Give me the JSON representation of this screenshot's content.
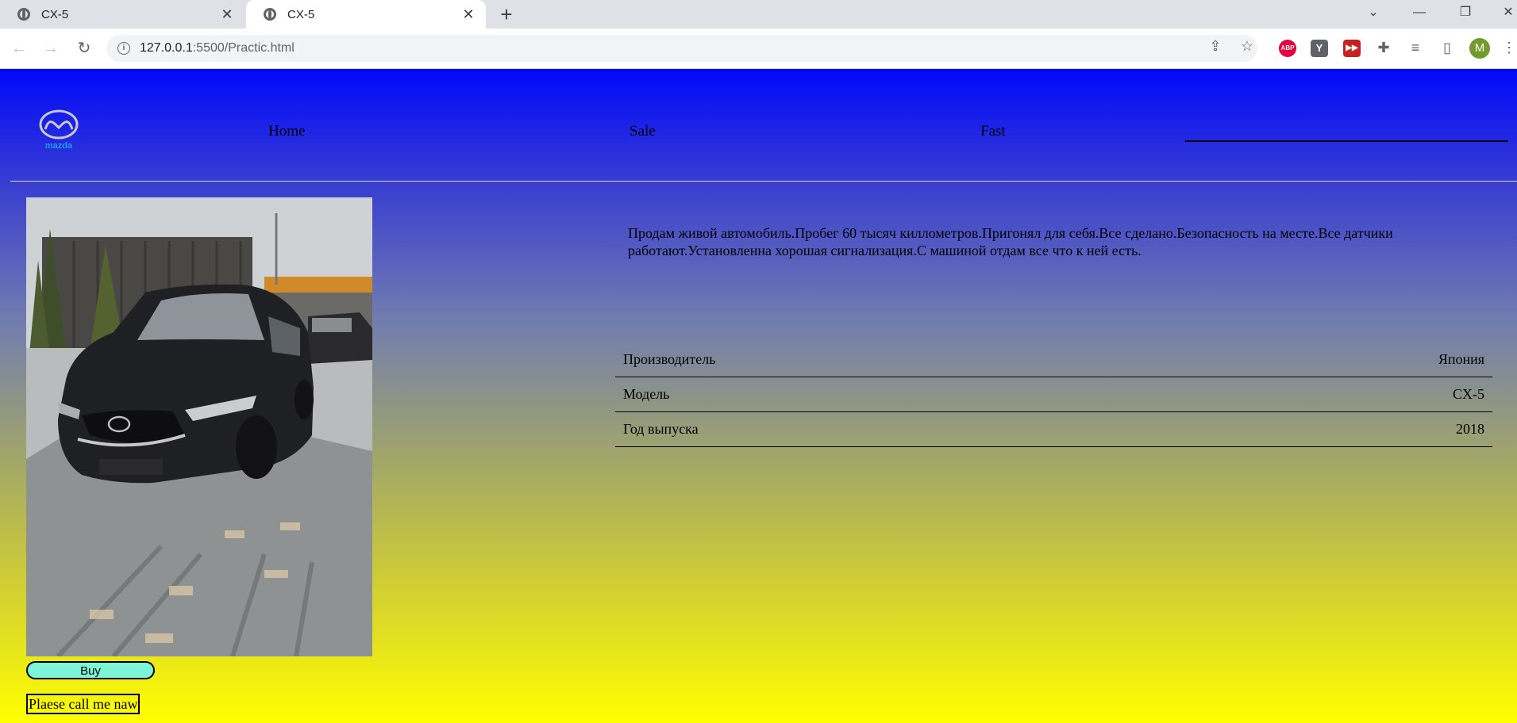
{
  "browser": {
    "tabs": [
      {
        "title": "CX-5",
        "active": false
      },
      {
        "title": "CX-5",
        "active": true
      }
    ],
    "url_host": "127.0.0.1",
    "url_rest": ":5500/Practic.html",
    "profile_initial": "M",
    "extensions": [
      "ABP",
      "Y"
    ]
  },
  "page": {
    "nav": {
      "home": "Home",
      "sale": "Sale",
      "fast": "Fast"
    },
    "logo_text": "mazda",
    "description": "Продам живой автомобиль.Пробег 60 тысяч киллометров.Пригонял для себя.Все сделано.Безопасность на месте.Все датчики работают.Установленна хорошая сигнализация.С машиной отдам все что к ней есть.",
    "specs": [
      {
        "label": "Производитель",
        "value": "Япония"
      },
      {
        "label": "Модель",
        "value": "CX-5"
      },
      {
        "label": "Год выпуска",
        "value": "2018"
      }
    ],
    "buy_label": "Buy",
    "call_text": "Plaese call me naw"
  },
  "colors": {
    "gradient_top": "#0008fb",
    "gradient_bottom": "#ffff00",
    "buy_button": "#7ff5d8"
  }
}
